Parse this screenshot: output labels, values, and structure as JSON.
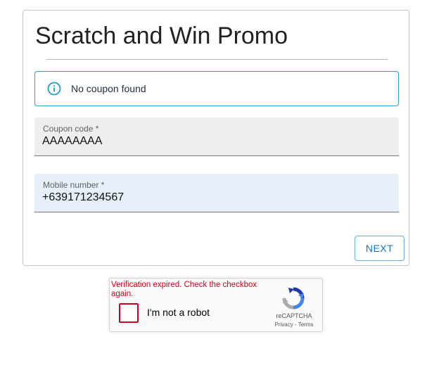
{
  "promo": {
    "title": "Scratch and Win Promo"
  },
  "alert": {
    "icon": "info-icon",
    "message": "No coupon found",
    "accent_color": "#29a3d6"
  },
  "fields": {
    "coupon": {
      "label": "Coupon code *",
      "value": "AAAAAAAA"
    },
    "mobile": {
      "label": "Mobile number *",
      "value": "+639171234567"
    }
  },
  "actions": {
    "next_label": "NEXT"
  },
  "recaptcha": {
    "error": "Verification expired. Check the checkbox again.",
    "checkbox_label": "I'm not a robot",
    "brand": "reCAPTCHA",
    "privacy_label": "Privacy",
    "separator": " - ",
    "terms_label": "Terms",
    "error_color": "#d0021b"
  }
}
